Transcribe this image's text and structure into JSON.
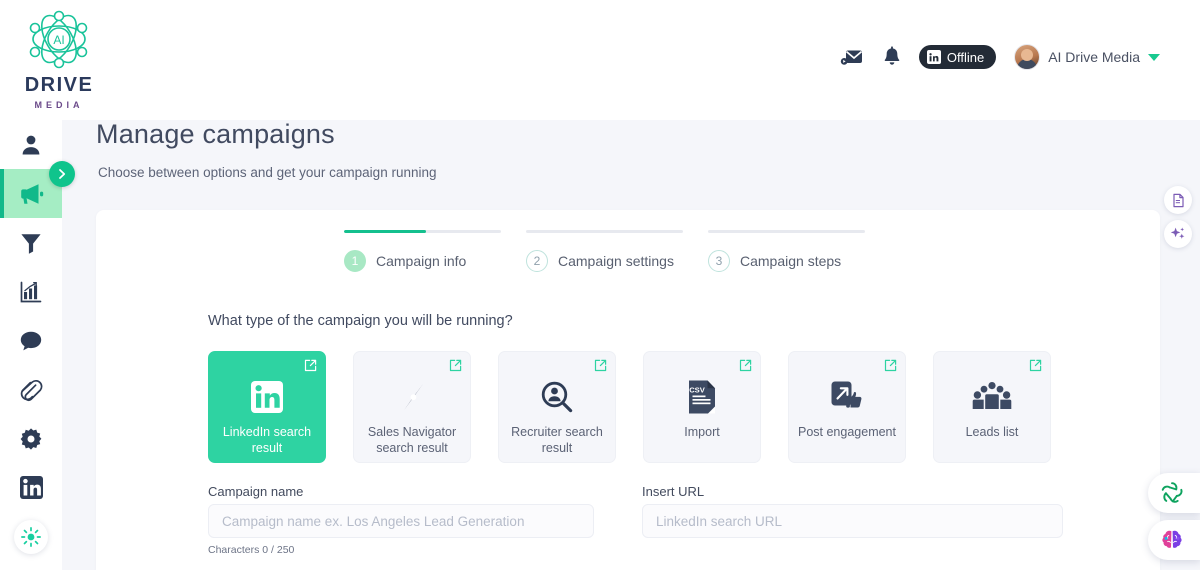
{
  "brand": {
    "word": "DRIVE",
    "sub": "MEDIA",
    "mark_icon": "atom-ai-logo-icon",
    "mark_label": "AI",
    "green": "#19c39a",
    "navy": "#2b3a5c",
    "purple": "#6b4a8a"
  },
  "header": {
    "mail_icon": "mail-icon",
    "bell_icon": "bell-notification-icon",
    "status": {
      "icon": "linkedin-icon",
      "label": "Offline"
    },
    "user": {
      "name": "AI Drive Media",
      "avatar_icon": "user-avatar",
      "caret_icon": "chevron-down-icon"
    }
  },
  "sidebar": {
    "expand_icon": "chevron-right-icon",
    "items": [
      {
        "icon": "person-icon",
        "name": "prospects",
        "active": false
      },
      {
        "icon": "megaphone-icon",
        "name": "campaigns",
        "active": true
      },
      {
        "icon": "funnel-icon",
        "name": "filters",
        "active": false
      },
      {
        "icon": "bar-chart-icon",
        "name": "analytics",
        "active": false
      },
      {
        "icon": "chat-bubble-icon",
        "name": "inbox",
        "active": false
      },
      {
        "icon": "paperclip-icon",
        "name": "attachments",
        "active": false
      },
      {
        "icon": "gear-icon",
        "name": "settings",
        "active": false
      },
      {
        "icon": "linkedin-icon",
        "name": "linkedin",
        "active": false
      },
      {
        "icon": "sun-burst-icon",
        "name": "theme",
        "active": false
      }
    ]
  },
  "page": {
    "title": "Manage campaigns",
    "subtitle": "Choose between options and get your campaign running"
  },
  "stepper": {
    "steps": [
      {
        "num": "1",
        "label": "Campaign info",
        "state": "done",
        "progress": 52
      },
      {
        "num": "2",
        "label": "Campaign settings",
        "state": "todo",
        "progress": 0
      },
      {
        "num": "3",
        "label": "Campaign steps",
        "state": "todo",
        "progress": 0
      }
    ]
  },
  "main": {
    "question": "What type of the campaign you will be running?",
    "campaign_types": [
      {
        "label": "LinkedIn search result",
        "icon": "linkedin-icon",
        "selected": true,
        "external_icon": "external-link-icon"
      },
      {
        "label": "Sales Navigator search result",
        "icon": "compass-icon",
        "selected": false,
        "external_icon": "external-link-icon"
      },
      {
        "label": "Recruiter search result",
        "icon": "person-search-icon",
        "selected": false,
        "external_icon": "external-link-icon"
      },
      {
        "label": "Import",
        "icon": "csv-file-icon",
        "selected": false,
        "external_icon": "external-link-icon"
      },
      {
        "label": "Post engagement",
        "icon": "post-thumbs-up-icon",
        "selected": false,
        "external_icon": "external-link-icon"
      },
      {
        "label": "Leads list",
        "icon": "people-group-icon",
        "selected": false,
        "external_icon": "external-link-icon"
      }
    ],
    "campaign_name": {
      "label": "Campaign name",
      "value": "",
      "placeholder": "Campaign name ex. Los Angeles Lead Generation",
      "counter": "Characters 0 / 250"
    },
    "insert_url": {
      "label": "Insert URL",
      "value": "",
      "placeholder": "LinkedIn search URL"
    }
  },
  "right_rail": {
    "top": [
      {
        "icon": "document-icon",
        "name": "notes-panel"
      },
      {
        "icon": "sparkles-icon",
        "name": "ai-assist-panel"
      }
    ],
    "bottom": [
      {
        "icon": "atom-green-icon",
        "name": "ai-atom-widget"
      },
      {
        "icon": "brain-icon",
        "name": "brain-widget"
      }
    ]
  },
  "colors": {
    "accent_green": "#2ed3a2",
    "accent_green_dark": "#11b98a",
    "active_sidebar": "#a5edc4",
    "page_bg": "#f5f6fa",
    "text_dark": "#414a60"
  }
}
